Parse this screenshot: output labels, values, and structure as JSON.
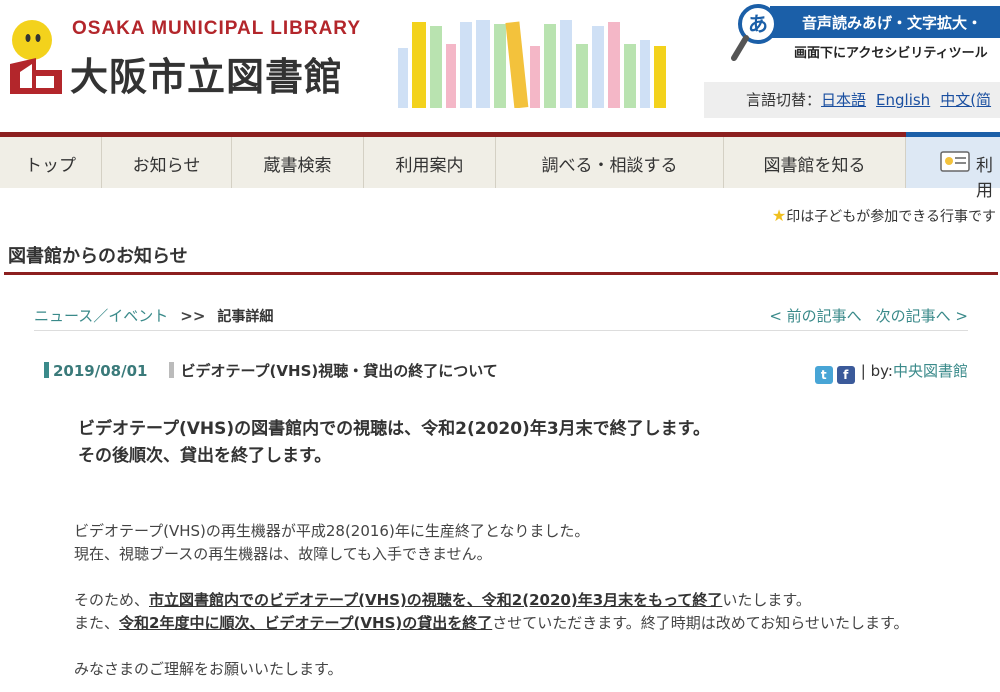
{
  "header": {
    "logo_en": "OSAKA MUNICIPAL LIBRARY",
    "logo_ja": "大阪市立図書館",
    "accessibility_title": "音声読みあげ・文字拡大・",
    "accessibility_sub": "画面下にアクセシビリティツール",
    "accessibility_glyph": "あ",
    "lang_label": "言語切替：",
    "languages": [
      "日本語",
      "English",
      "中文(简"
    ]
  },
  "nav": {
    "items": [
      "トップ",
      "お知らせ",
      "蔵書検索",
      "利用案内",
      "調べる・相談する",
      "図書館を知る",
      "利用"
    ]
  },
  "kids_note": {
    "star": "★",
    "text": "印は子どもが参加できる行事です"
  },
  "section": {
    "title": "図書館からのお知らせ"
  },
  "breadcrumb": {
    "parent": "ニュース／イベント",
    "separator": ">>",
    "current": "記事詳細",
    "prev": "< 前の記事へ",
    "next": "次の記事へ >"
  },
  "article": {
    "date": "2019/08/01",
    "title": "ビデオテープ(VHS)視聴・貸出の終了について",
    "twitter": "t",
    "facebook": "f",
    "by_label": "| by:",
    "author": "中央図書館",
    "lead_1": "ビデオテープ(VHS)の図書館内での視聴は、令和2(2020)年3月末で終了します。",
    "lead_2": "その後順次、貸出を終了します。",
    "p1_1": "ビデオテープ(VHS)の再生機器が平成28(2016)年に生産終了となりました。",
    "p1_2": "現在、視聴ブースの再生機器は、故障しても入手できません。",
    "p2_1_pre": "そのため、",
    "p2_1_bold": "市立図書館内でのビデオテープ(VHS)の視聴を、令和2(2020)年3月末をもって終了",
    "p2_1_post": "いたします。",
    "p2_2_pre": "また、",
    "p2_2_bold": "令和2年度中に順次、ビデオテープ(VHS)の貸出を終了",
    "p2_2_post": "させていただきます。終了時期は改めてお知らせいたします。",
    "p3": "みなさまのご理解をお願いいたします。"
  },
  "colors": {
    "brand_red": "#8c1f1f",
    "accent_teal": "#3a8a8a",
    "access_blue": "#1b5fa8"
  }
}
